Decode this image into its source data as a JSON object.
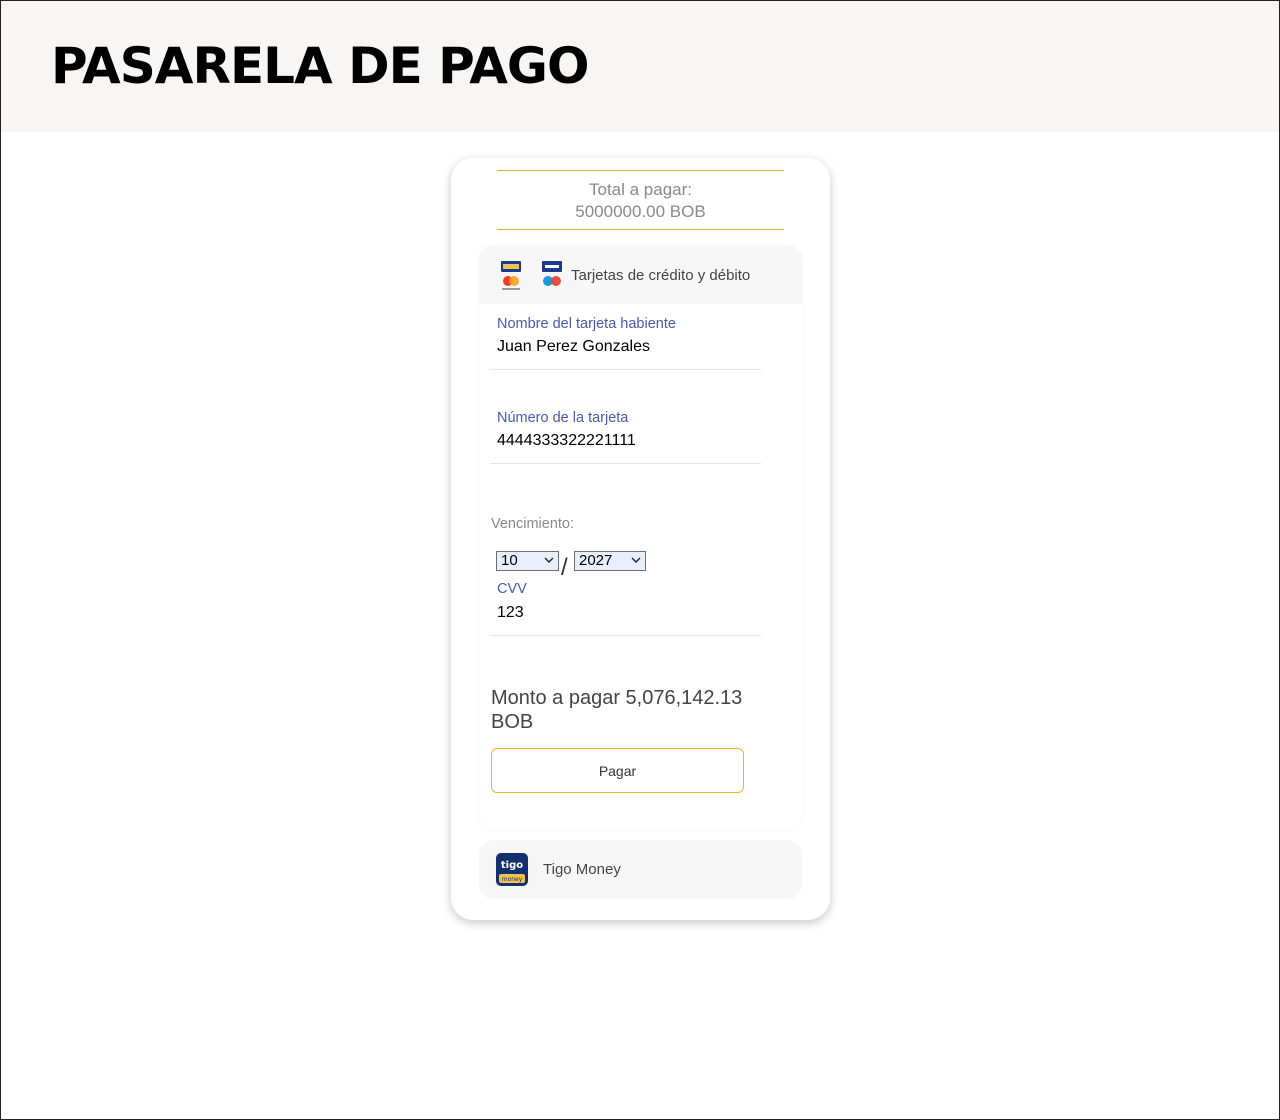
{
  "header": {
    "title": "PASARELA DE PAGO"
  },
  "summary": {
    "total_label": "Total a pagar:",
    "total_value": "5000000.00 BOB"
  },
  "methods": {
    "cards": {
      "title": "Tarjetas de crédito y débito",
      "icons": [
        "visa-mastercard-logo",
        "visa-maestro-logo"
      ],
      "form": {
        "name_label": "Nombre del tarjeta habiente",
        "name_value": "Juan Perez Gonzales",
        "number_label": "Número de la tarjeta",
        "number_value": "4444333322221111",
        "expiry_label": "Vencimiento:",
        "month_value": "10",
        "expiry_separator": "/",
        "year_value": "2027",
        "cvv_label": "CVV",
        "cvv_value": "123"
      },
      "amount_text": "Monto a pagar 5,076,142.13 BOB",
      "pay_label": "Pagar"
    },
    "tigo": {
      "title": "Tigo Money",
      "icon": "tigo-money-logo"
    }
  },
  "colors": {
    "accent": "#f0b429",
    "label_blue": "#4a5aa8",
    "header_bg": "#f7f6f4"
  }
}
